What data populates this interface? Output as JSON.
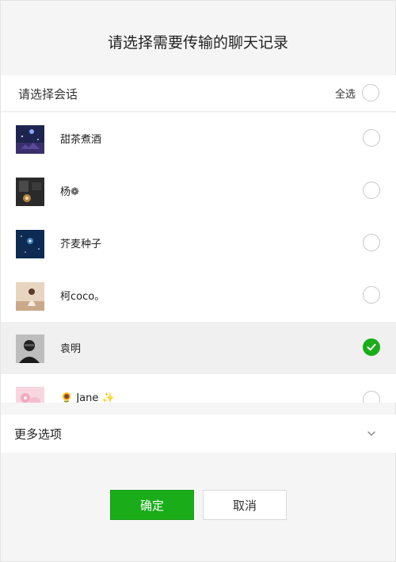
{
  "dialog": {
    "title": "请选择需要传输的聊天记录",
    "section_label": "请选择会话",
    "select_all_label": "全选"
  },
  "chats": [
    {
      "name": "甜茶煮酒",
      "avatar": "night-sky-avatar",
      "selected": false
    },
    {
      "name": "杨❁",
      "avatar": "candle-room-avatar",
      "selected": false
    },
    {
      "name": "芥麦种子",
      "avatar": "starry-blue-avatar",
      "selected": false
    },
    {
      "name": "柯coco。",
      "avatar": "girl-photo-avatar",
      "selected": false
    },
    {
      "name": "袁明",
      "avatar": "man-portrait-avatar",
      "selected": true
    },
    {
      "name": "🌻 Jane ✨",
      "avatar": "pink-flower-avatar",
      "selected": false
    }
  ],
  "more_options": {
    "label": "更多选项",
    "icon": "chevron-down-icon"
  },
  "buttons": {
    "confirm": "确定",
    "cancel": "取消"
  },
  "colors": {
    "accent": "#1aad19",
    "selected_row": "#f0f0f0"
  }
}
